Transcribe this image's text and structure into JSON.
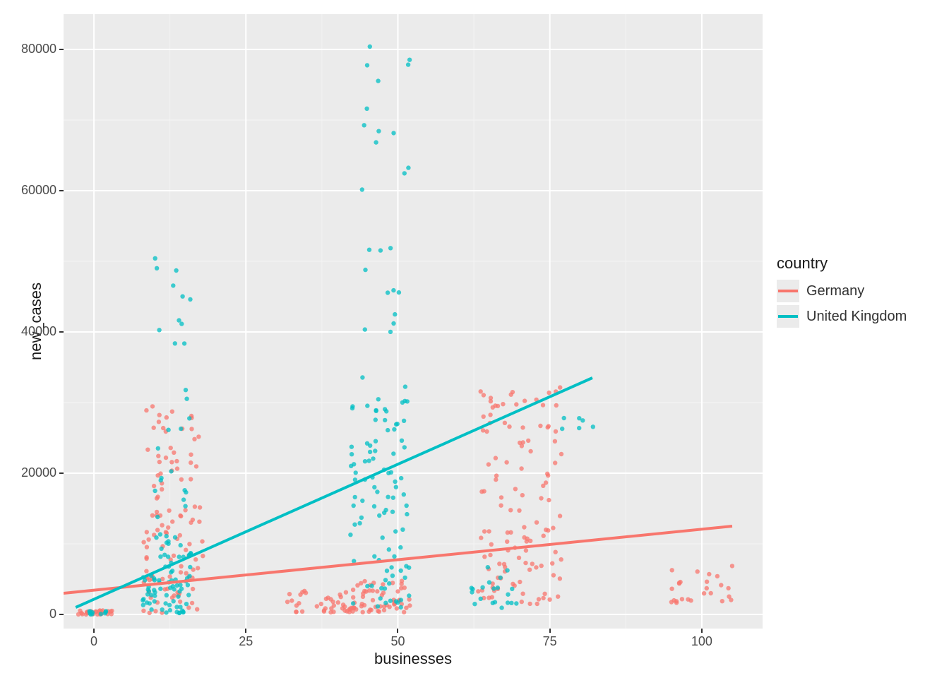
{
  "chart_data": {
    "type": "scatter",
    "xlabel": "businesses",
    "ylabel": "new_cases",
    "xlim": [
      -5,
      110
    ],
    "ylim": [
      -2000,
      85000
    ],
    "x_ticks": [
      0,
      25,
      50,
      75,
      100
    ],
    "y_ticks": [
      0,
      20000,
      40000,
      60000,
      80000
    ],
    "y_tick_labels": [
      "0",
      "20000",
      "40000",
      "60000",
      "80000"
    ],
    "legend_title": "country",
    "series": [
      {
        "name": "Germany",
        "color": "#F8766D",
        "trend": {
          "x1": -5,
          "y1": 3000,
          "x2": 105,
          "y2": 12500
        },
        "clusters": [
          {
            "x_center": 0,
            "x_spread": 3,
            "y_min": 0,
            "y_max": 600,
            "n": 25
          },
          {
            "x_center": 13,
            "x_spread": 5,
            "y_min": 200,
            "y_max": 30000,
            "n": 110
          },
          {
            "x_center": 37,
            "x_spread": 6,
            "y_min": 300,
            "y_max": 3500,
            "n": 40
          },
          {
            "x_center": 47,
            "x_spread": 5,
            "y_min": 300,
            "y_max": 5000,
            "n": 55
          },
          {
            "x_center": 70,
            "x_spread": 7,
            "y_min": 1500,
            "y_max": 33000,
            "n": 120
          },
          {
            "x_center": 100,
            "x_spread": 5,
            "y_min": 1500,
            "y_max": 7000,
            "n": 25
          }
        ]
      },
      {
        "name": "United Kingdom",
        "color": "#00BFC4",
        "trend": {
          "x1": -3,
          "y1": 1000,
          "x2": 82,
          "y2": 33500
        },
        "clusters": [
          {
            "x_center": 0,
            "x_spread": 2,
            "y_min": 0,
            "y_max": 500,
            "n": 10
          },
          {
            "x_center": 12,
            "x_spread": 4,
            "y_min": 200,
            "y_max": 9000,
            "n": 70
          },
          {
            "x_center": 13,
            "x_spread": 3,
            "y_min": 9000,
            "y_max": 53000,
            "n": 35
          },
          {
            "x_center": 47,
            "x_spread": 5,
            "y_min": 1000,
            "y_max": 30000,
            "n": 90
          },
          {
            "x_center": 48,
            "x_spread": 4,
            "y_min": 30000,
            "y_max": 82000,
            "n": 30
          },
          {
            "x_center": 66,
            "x_spread": 4,
            "y_min": 300,
            "y_max": 7000,
            "n": 20
          },
          {
            "x_center": 80,
            "x_spread": 3,
            "y_min": 25000,
            "y_max": 28000,
            "n": 6
          }
        ]
      }
    ]
  },
  "legend": {
    "title": "country",
    "items": [
      "Germany",
      "United Kingdom"
    ]
  }
}
